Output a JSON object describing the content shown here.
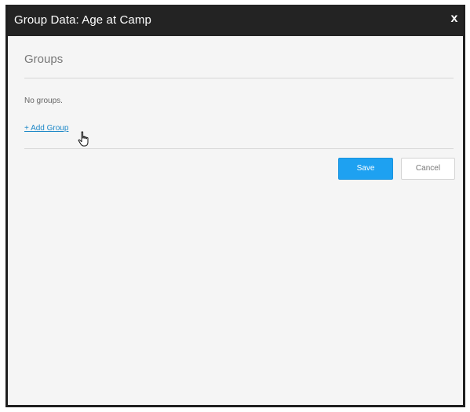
{
  "dialog": {
    "title": "Group Data: Age at Camp",
    "close_label": "x"
  },
  "groups": {
    "heading": "Groups",
    "empty_message": "No groups.",
    "add_link": "+ Add Group"
  },
  "actions": {
    "save_label": "Save",
    "cancel_label": "Cancel"
  },
  "colors": {
    "titlebar": "#232323",
    "primary": "#1ea1f1",
    "link": "#1e88c8",
    "background": "#f5f5f5"
  }
}
